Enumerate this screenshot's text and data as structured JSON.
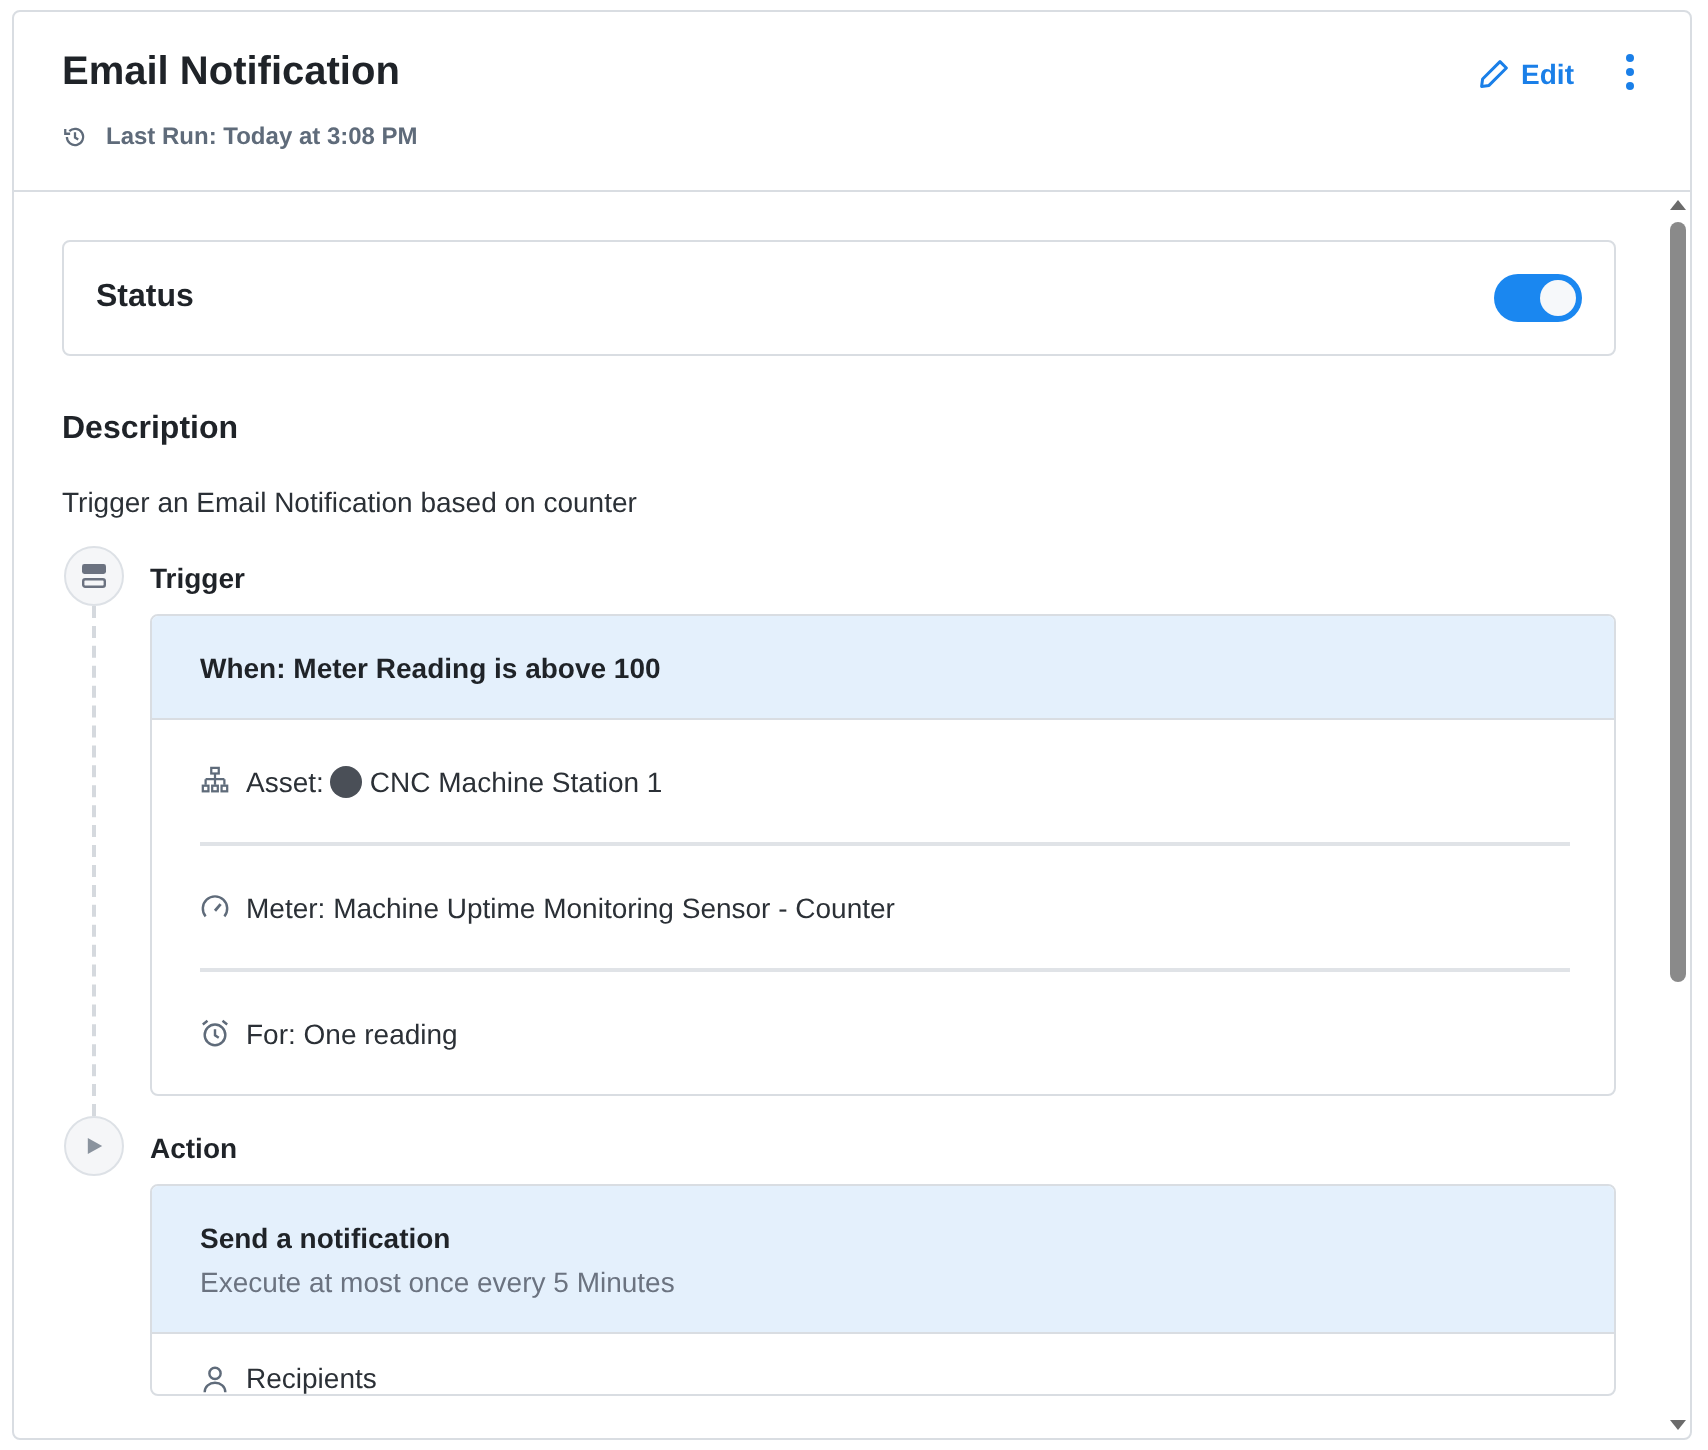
{
  "header": {
    "title": "Email Notification",
    "last_run": "Last Run: Today at 3:08 PM",
    "edit_label": "Edit"
  },
  "status": {
    "label": "Status",
    "on": true
  },
  "description": {
    "heading": "Description",
    "text": "Trigger an Email Notification based on counter"
  },
  "steps": [
    {
      "kind": "trigger",
      "label": "Trigger",
      "card": {
        "title": "When: Meter Reading is above 100",
        "rows": [
          {
            "kind": "asset",
            "label": "Asset:",
            "value": "CNC Machine Station 1"
          },
          {
            "kind": "meter",
            "label": "Meter: Machine Uptime Monitoring Sensor - Counter"
          },
          {
            "kind": "duration",
            "label": "For: One reading"
          }
        ]
      }
    },
    {
      "kind": "action",
      "label": "Action",
      "card": {
        "title": "Send a notification",
        "subtitle": "Execute at most once every 5 Minutes",
        "rows": [
          {
            "kind": "recipients",
            "label": "Recipients"
          }
        ]
      }
    }
  ]
}
